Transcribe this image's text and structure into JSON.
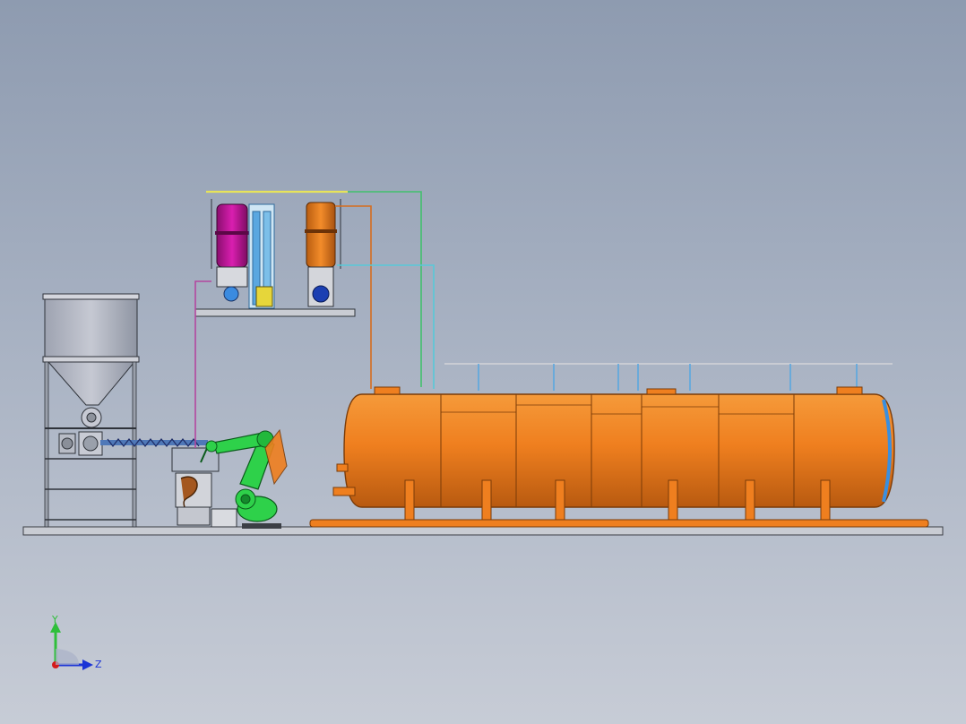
{
  "viewport": {
    "background_top": "#8e9bb0",
    "background_bottom": "#c7ccd6"
  },
  "triad": {
    "y_label": "Y",
    "z_label": "Z",
    "y_color": "#2fbf3a",
    "z_color": "#1b34d6",
    "x_color": "#d41b1b"
  },
  "colors": {
    "tank_orange": "#ef7f1f",
    "tank_edge": "#7a3b08",
    "magenta_vessel": "#c2129a",
    "blue_vessel": "#5aa7e0",
    "robot_green": "#2ed14a",
    "hopper_grey": "#b3b7c4",
    "frame_grey": "#8d929c",
    "pipe_yellow": "#e7e35a",
    "pipe_cyan": "#57c9d8",
    "pipe_purple": "#b3479f",
    "pipe_orange": "#d66d1e",
    "pipe_green": "#42c06d"
  },
  "icons": {
    "hopper": "hopper-icon",
    "robot_arm": "robot-arm-icon",
    "storage_tank": "horizontal-tank-icon",
    "dosing_skid": "dosing-skid-icon",
    "axis_triad": "axis-triad-icon"
  }
}
